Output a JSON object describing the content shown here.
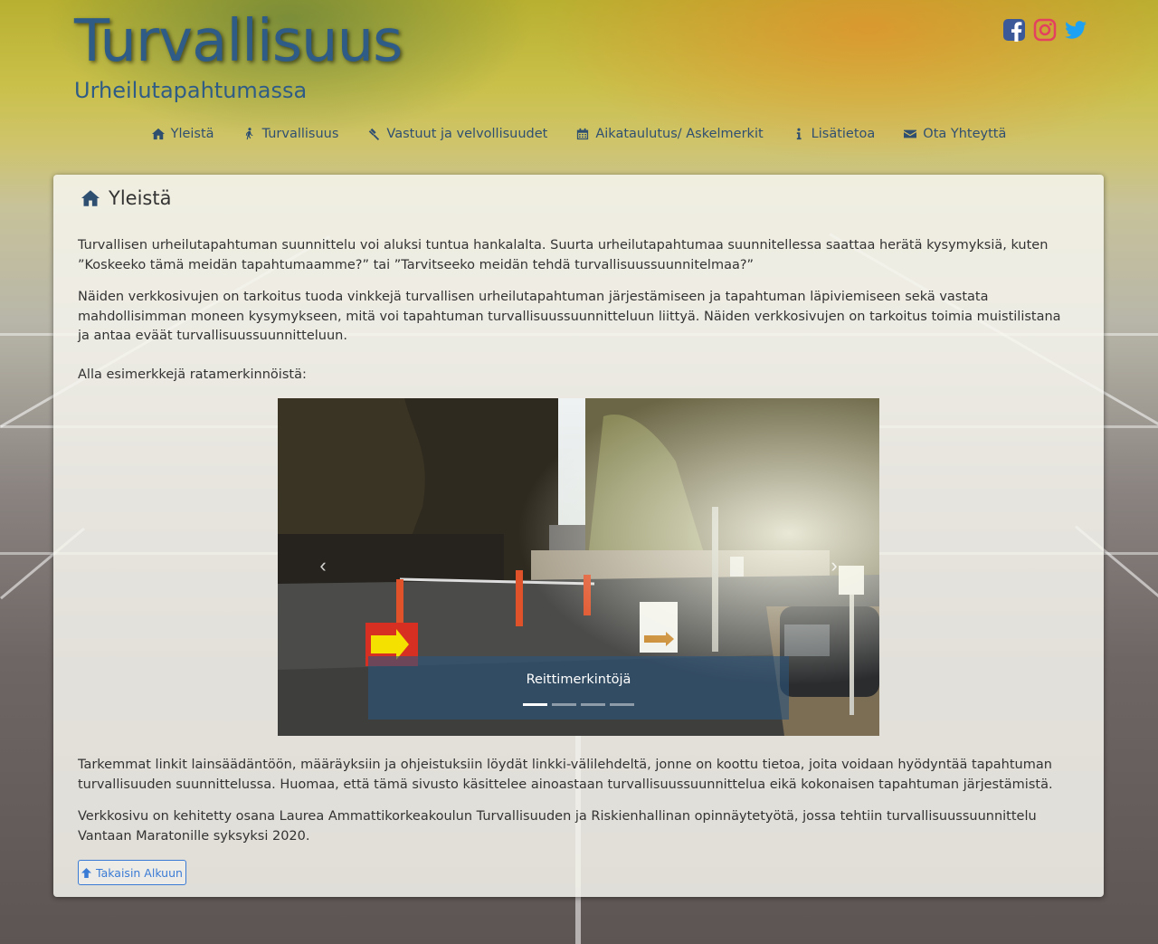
{
  "site": {
    "title": "Turvallisuus",
    "subtitle": "Urheilutapahtumassa"
  },
  "social": [
    {
      "icon": "facebook-icon",
      "color": "#3b5998"
    },
    {
      "icon": "instagram-icon",
      "color": "#e4405f"
    },
    {
      "icon": "twitter-icon",
      "color": "#1da1f2"
    }
  ],
  "nav": {
    "items": [
      {
        "label": "Yleistä",
        "icon": "home-icon"
      },
      {
        "label": "Turvallisuus",
        "icon": "walking-person-icon"
      },
      {
        "label": "Vastuut ja velvollisuudet",
        "icon": "gavel-icon"
      },
      {
        "label": "Aikataulutus/ Askelmerkit",
        "icon": "calendar-icon"
      },
      {
        "label": "Lisätietoa",
        "icon": "info-icon"
      },
      {
        "label": "Ota Yhteyttä",
        "icon": "envelope-icon"
      }
    ]
  },
  "panel": {
    "heading": "Yleistä",
    "paragraphs": [
      "Turvallisen urheilutapahtuman suunnittelu voi aluksi tuntua hankalalta. Suurta urheilutapahtumaa suunnitellessa saattaa herätä kysymyksiä, kuten ”Koskeeko tämä meidän tapahtumaamme?” tai ”Tarvitseeko meidän tehdä turvallisuussuunnitelmaa?”",
      "Näiden verkkosivujen on tarkoitus tuoda vinkkejä turvallisen urheilutapahtuman järjestämiseen ja tapahtuman läpiviemiseen sekä vastata mahdollisimman moneen kysymykseen, mitä voi tapahtuman turvallisuussuunnitteluun liittyä. Näiden verkkosivujen on tarkoitus toimia muistilistana ja antaa eväät turvallisuussuunnitteluun.",
      "Alla esimerkkejä ratamerkinnöistä:",
      "Tarkemmat linkit lainsäädäntöön, määräyksiin ja ohjeistuksiin löydät linkki-välilehdeltä, jonne on koottu tietoa, joita voidaan hyödyntää tapahtuman turvallisuuden suunnittelussa. Huomaa, että tämä sivusto käsittelee ainoastaan turvallisuussuunnittelua eikä kokonaisen tapahtuman järjestämistä.",
      "Verkkosivu on kehitetty osana Laurea Ammattikorkeakoulun Turvallisuuden ja Riskienhallinan opinnäytetyötä, jossa tehtiin turvallisuussuunnittelu Vantaan Maratonille syksyksi 2020."
    ],
    "carousel": {
      "caption": "Reittimerkintöjä",
      "slide_count": 4,
      "active_index": 0
    },
    "back_button": "Takaisin Alkuun"
  },
  "colors": {
    "brand": "#2f5c86",
    "nav_text": "#2f4f71",
    "button": "#3a7bd5"
  }
}
